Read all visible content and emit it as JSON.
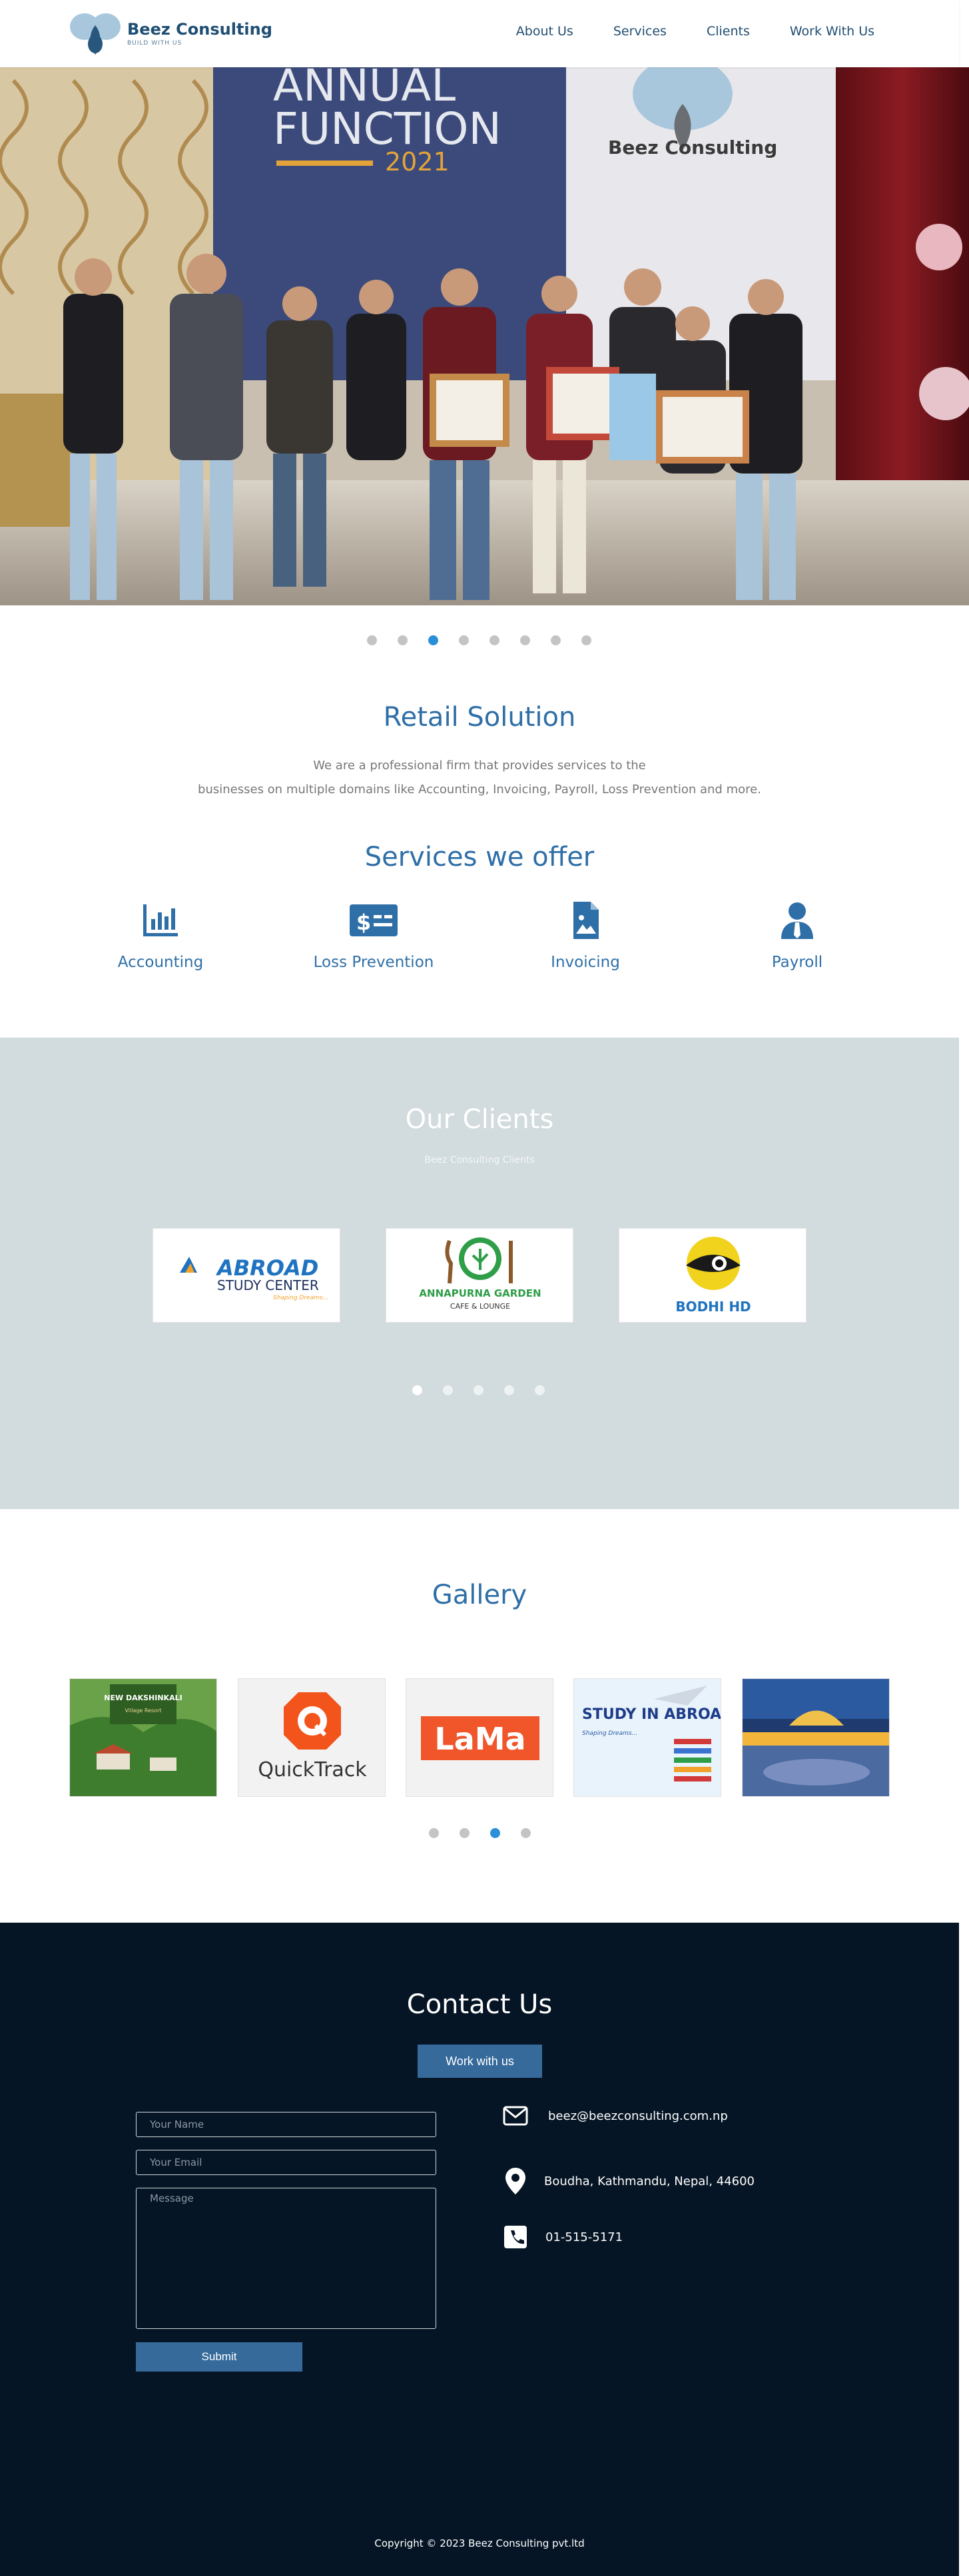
{
  "header": {
    "logo_name": "Beez Consulting",
    "logo_tag": "BUILD WITH US",
    "nav": [
      "About Us",
      "Services",
      "Clients",
      "Work With Us"
    ]
  },
  "hero": {
    "banner_line1": "ANNUAL",
    "banner_line2": "FUNCTION",
    "banner_year": "2021",
    "backdrop_brand": "Beez Consulting",
    "slide_count": 8,
    "active_slide": 3
  },
  "retail": {
    "title": "Retail Solution",
    "desc_line1": "We are a professional firm that provides services to the",
    "desc_line2": "businesses on multiple domains like Accounting, Invoicing, Payroll, Loss Prevention and more."
  },
  "services": {
    "title": "Services we offer",
    "items": [
      {
        "label": "Accounting",
        "icon": "bar-chart-icon"
      },
      {
        "label": "Loss Prevention",
        "icon": "dollar-card-icon"
      },
      {
        "label": "Invoicing",
        "icon": "document-image-icon"
      },
      {
        "label": "Payroll",
        "icon": "user-tie-icon"
      }
    ]
  },
  "clients": {
    "title": "Our Clients",
    "subtitle": "Beez Consulting Clients",
    "logos": [
      {
        "name": "ABROAD",
        "line2": "STUDY CENTER",
        "tagline": "Shaping Dreams..."
      },
      {
        "name": "ANNAPURNA GARDEN",
        "line2": "CAFE & LOUNGE"
      },
      {
        "name": "BODHI HD"
      }
    ],
    "slide_count": 5,
    "active_slide": 1
  },
  "gallery": {
    "title": "Gallery",
    "items": [
      {
        "label": "NEW DAKSHINKALI",
        "sub": "Village Resort"
      },
      {
        "label": "QuickTrack"
      },
      {
        "label": "LaMa"
      },
      {
        "label": "STUDY IN ABROAD",
        "sub": "Shaping Dreams..."
      },
      {
        "label": ""
      }
    ],
    "slide_count": 4,
    "active_slide": 3
  },
  "contact": {
    "title": "Contact Us",
    "work_button": "Work with us",
    "name_placeholder": "Your Name",
    "email_placeholder": "Your Email",
    "message_placeholder": "Message",
    "submit": "Submit",
    "email": "beez@beezconsulting.com.np",
    "address": "Boudha, Kathmandu, Nepal, 44600",
    "phone": "01-515-5171"
  },
  "footer": {
    "copyright": "Copyright © 2023 Beez Consulting pvt.ltd"
  },
  "colors": {
    "brand_blue": "#2f6fa7",
    "nav_navy": "#1f4e73",
    "active_dot": "#2a8fd8",
    "clients_bg": "#d2dbdd",
    "contact_bg": "#061525",
    "button_blue": "#366a9b"
  }
}
